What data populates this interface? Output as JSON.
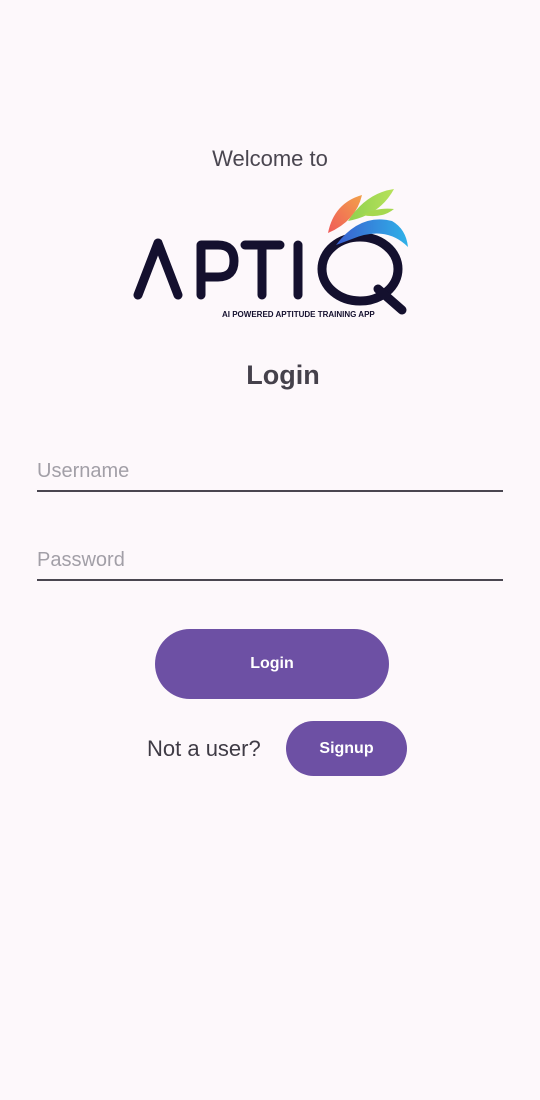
{
  "welcome_text": "Welcome to",
  "logo": {
    "wordmark": "APTIQ",
    "tagline": "AI POWERED APTITUDE TRAINING APP",
    "text_color": "#14102e",
    "leaf_colors": [
      "#f05a5a",
      "#f2a14a",
      "#8fd14f",
      "#3aa0e8"
    ]
  },
  "form": {
    "title": "Login",
    "username_placeholder": "Username",
    "password_placeholder": "Password",
    "login_label": "Login",
    "prompt_text": "Not a user?",
    "signup_label": "Signup"
  },
  "colors": {
    "background": "#fdf8fb",
    "button": "#6d50a4",
    "button_text": "#ffffff"
  }
}
